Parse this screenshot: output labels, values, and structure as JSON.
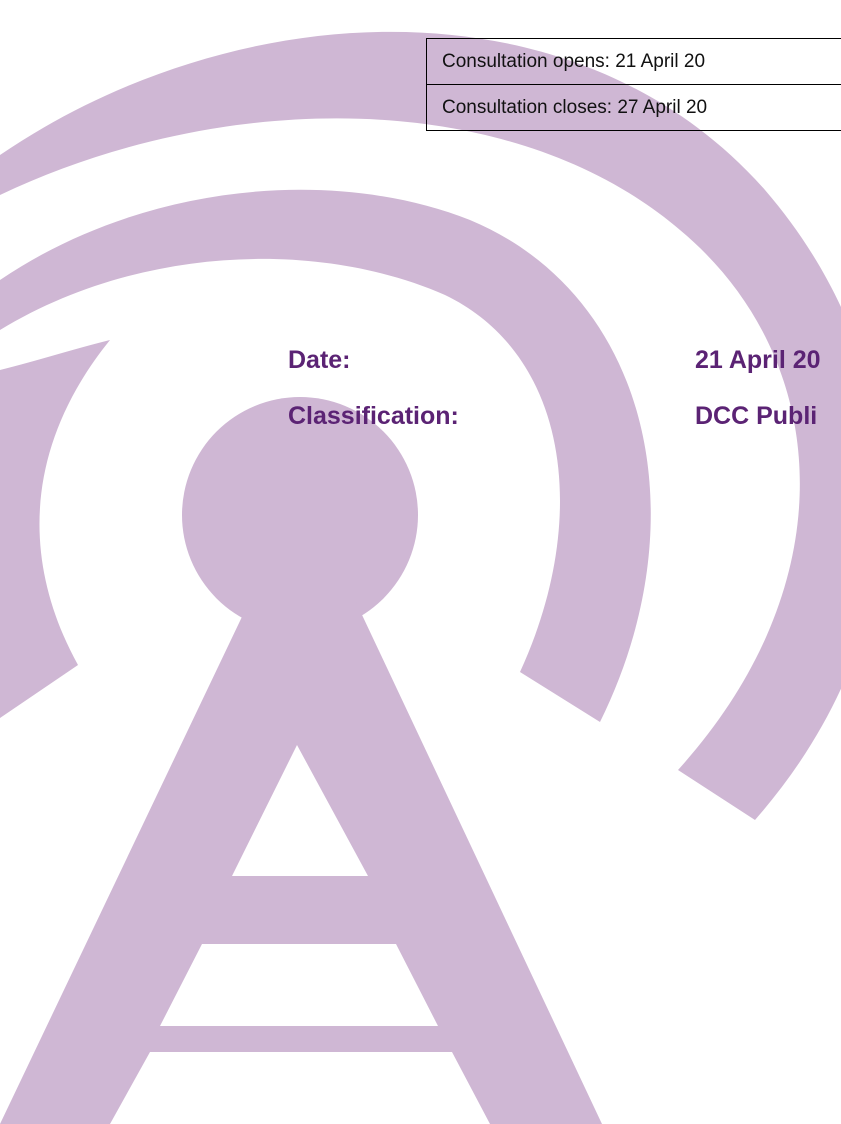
{
  "consultation": {
    "opens": "Consultation opens: 21 April 20",
    "closes": "Consultation closes: 27 April 20"
  },
  "meta": {
    "date_label": "Date:",
    "date_value": "21 April 20",
    "classification_label": "Classification:",
    "classification_value": "DCC Publi"
  },
  "watermark": {
    "icon": "radio-tower-icon",
    "color": "#cfb7d4"
  },
  "colors": {
    "heading_purple": "#5b2374",
    "border": "#000000"
  }
}
